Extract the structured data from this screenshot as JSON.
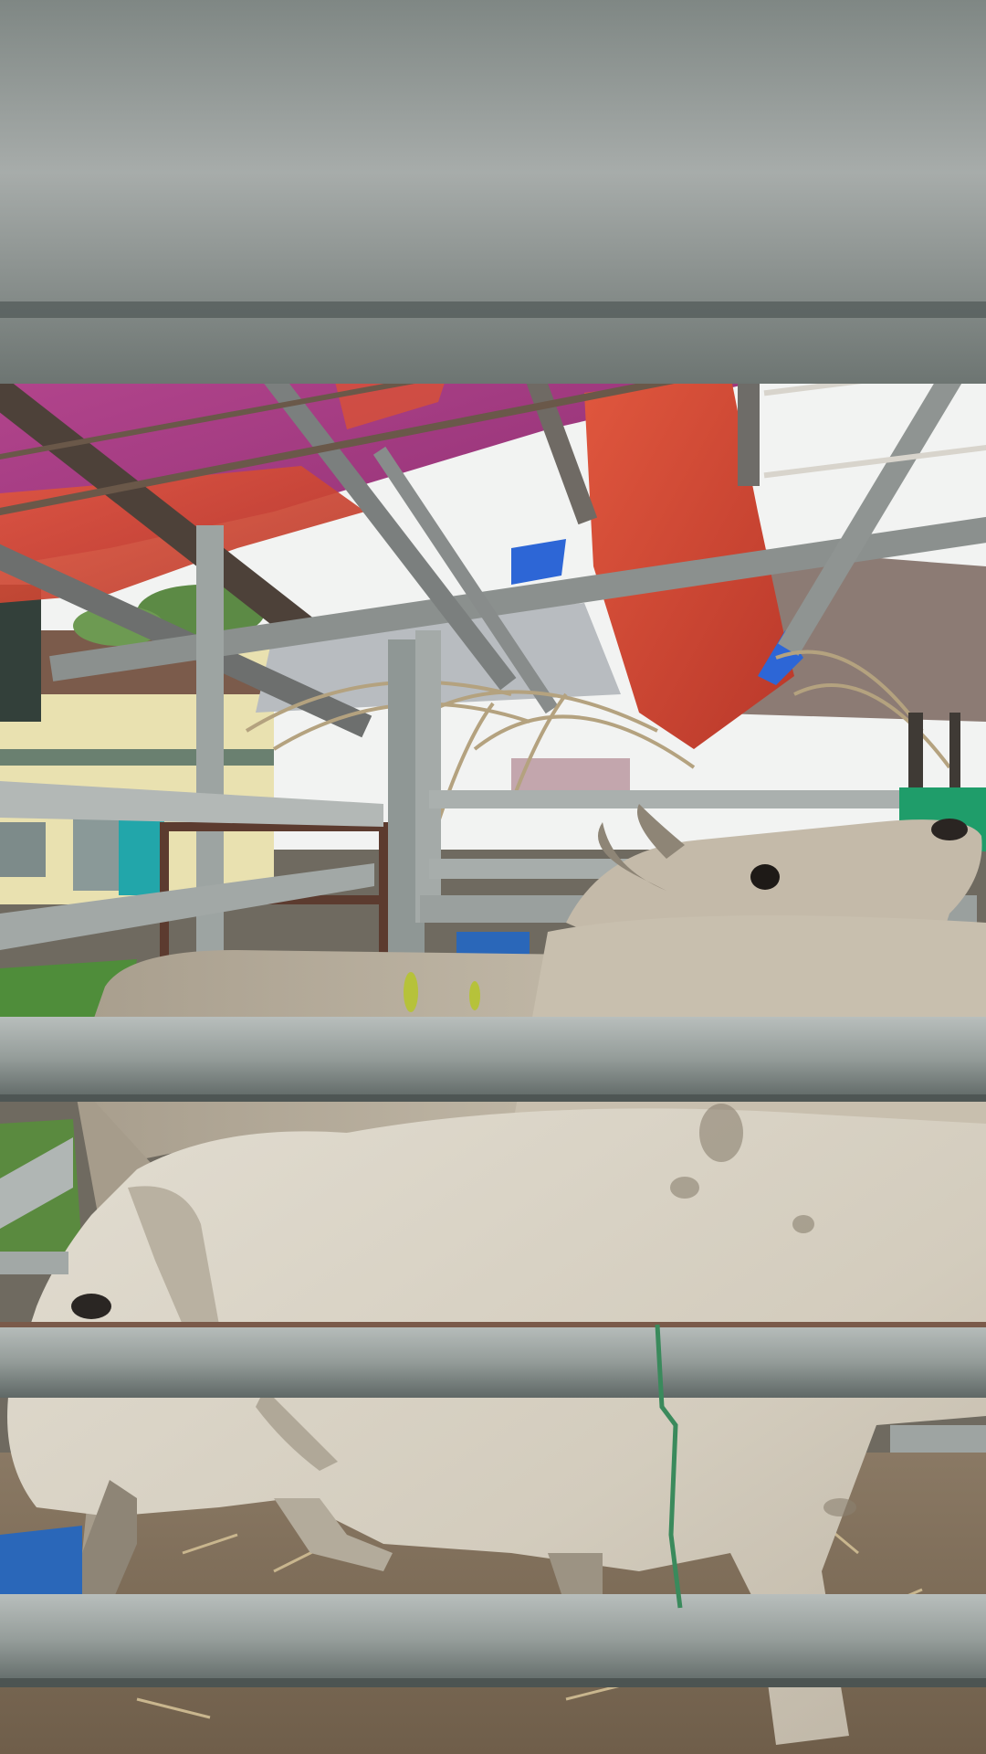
{
  "photo": {
    "subject": "cattle-pen",
    "colors": {
      "sky": "#f4f5f4",
      "tarp_purple": "#a4347e",
      "tarp_red": "#d24a34",
      "tarp_blue": "#2d66d6",
      "cow_light": "#d8d2c5",
      "cow_mid": "#b9b1a1",
      "cow_dark": "#8e8576",
      "rail_steel": "#8f9896",
      "rail_light": "#b6bcba",
      "ground": "#7c6a55",
      "grass": "#4f8d3a",
      "building_wall": "#ece4b4",
      "teal_wall": "#22a6aa",
      "rust_gate": "#5c3b2f",
      "roof_metal": "#8a7a72",
      "thatch": "#b4a27f",
      "blue_barrel": "#2a67b9",
      "green_cloth": "#1f9d6a",
      "twine": "#3a8a5c"
    }
  }
}
